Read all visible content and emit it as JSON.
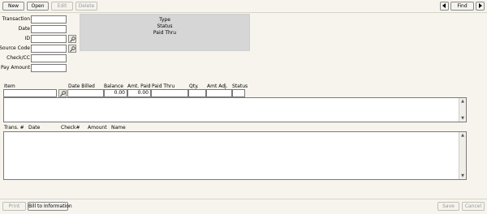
{
  "toolbar": {
    "new_label": "New",
    "open_label": "Open",
    "edit_label": "Edit",
    "delete_label": "Delete",
    "find_label": "Find",
    "prev_icon": "triangle-left-icon",
    "next_icon": "triangle-right-icon"
  },
  "form": {
    "transaction_label": "Transaction",
    "transaction_value": "",
    "date_label": "Date",
    "date_value": "",
    "id_label": "ID",
    "id_value": "",
    "source_code_label": "Source Code",
    "source_code_value": "",
    "check_cc_label": "Check/CC",
    "check_cc_value": "",
    "pay_amount_label": "Pay Amount",
    "pay_amount_value": "",
    "lookup_icon": "magnifier-icon"
  },
  "info_panel": {
    "type_label": "Type",
    "status_label": "Status",
    "paid_thru_label": "Paid Thru"
  },
  "items": {
    "columns": [
      "Item",
      "Date Billed",
      "Balance",
      "Amt. Paid",
      "Paid Thru",
      "Qty.",
      "Amt Adj.",
      "Status"
    ],
    "row": {
      "item": "",
      "date_billed": "",
      "balance": "0.00",
      "amt_paid": "0.00",
      "paid_thru": "",
      "qty": "",
      "amt_adj": "",
      "status": ""
    }
  },
  "transactions": {
    "columns": [
      "Trans. #",
      "Date",
      "Check#",
      "Amount",
      "Name"
    ]
  },
  "footer": {
    "print_label": "Print",
    "bill_to_label": "Bill to Information",
    "save_label": "Save",
    "cancel_label": "Cancel"
  },
  "colors": {
    "background": "#f6f4ec",
    "info_panel": "#d6d6d6",
    "field_border": "#7a7a7a"
  }
}
